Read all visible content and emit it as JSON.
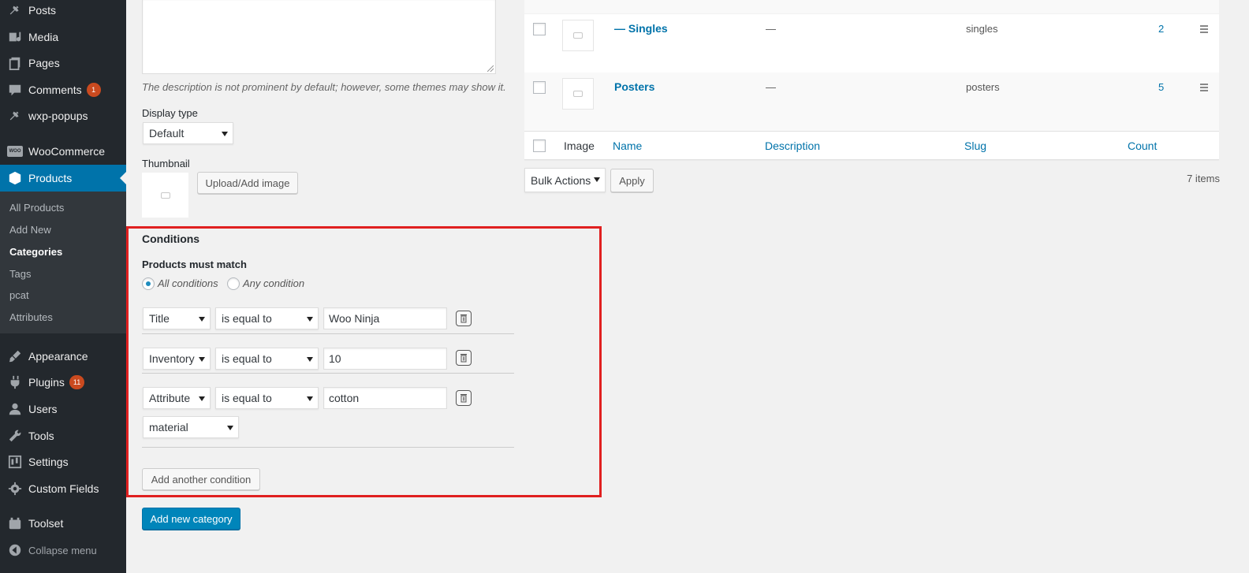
{
  "sidebar": {
    "items": [
      {
        "label": "Posts",
        "icon": "pin-icon"
      },
      {
        "label": "Media",
        "icon": "media-icon"
      },
      {
        "label": "Pages",
        "icon": "pages-icon"
      },
      {
        "label": "Comments",
        "icon": "comment-icon",
        "badge": "1"
      },
      {
        "label": "wxp-popups",
        "icon": "pin-icon"
      },
      {
        "label": "WooCommerce",
        "icon": "woo-icon"
      },
      {
        "label": "Products",
        "icon": "products-icon"
      },
      {
        "label": "Appearance",
        "icon": "brush-icon"
      },
      {
        "label": "Plugins",
        "icon": "plugin-icon",
        "badge": "11"
      },
      {
        "label": "Users",
        "icon": "user-icon"
      },
      {
        "label": "Tools",
        "icon": "wrench-icon"
      },
      {
        "label": "Settings",
        "icon": "settings-icon"
      },
      {
        "label": "Custom Fields",
        "icon": "gear-icon"
      },
      {
        "label": "Toolset",
        "icon": "toolset-icon"
      },
      {
        "label": "Collapse menu",
        "icon": "collapse-icon"
      }
    ],
    "woo_logo": "WOO",
    "submenu": [
      "All Products",
      "Add New",
      "Categories",
      "Tags",
      "pcat",
      "Attributes"
    ]
  },
  "form": {
    "description_hint": "The description is not prominent by default; however, some themes may show it.",
    "display_type_label": "Display type",
    "display_type_value": "Default",
    "thumbnail_label": "Thumbnail",
    "upload_button": "Upload/Add image",
    "submit_button": "Add new category"
  },
  "conditions": {
    "title": "Conditions",
    "match_label": "Products must match",
    "option_all": "All conditions",
    "option_any": "Any condition",
    "selected_option": "all",
    "rules": [
      {
        "field": "Title",
        "operator": "is equal to",
        "value": "Woo Ninja"
      },
      {
        "field": "Inventory",
        "operator": "is equal to",
        "value": "10"
      },
      {
        "field": "Attribute",
        "operator": "is equal to",
        "value": "cotton",
        "attribute": "material"
      }
    ],
    "add_button": "Add another condition"
  },
  "table": {
    "rows": [
      {
        "name": "— Singles",
        "description": "—",
        "slug": "singles",
        "count": "2"
      },
      {
        "name": "Posters",
        "description": "—",
        "slug": "posters",
        "count": "5"
      }
    ],
    "columns": {
      "image": "Image",
      "name": "Name",
      "description": "Description",
      "slug": "Slug",
      "count": "Count"
    },
    "bulk_actions": "Bulk Actions",
    "apply": "Apply",
    "items_count": "7 items"
  },
  "colors": {
    "sidebar_bg": "#23282d",
    "active_bg": "#0073aa",
    "link": "#0073aa",
    "highlight_border": "#e02020",
    "primary_button": "#0085ba",
    "badge": "#ca4a1f"
  }
}
